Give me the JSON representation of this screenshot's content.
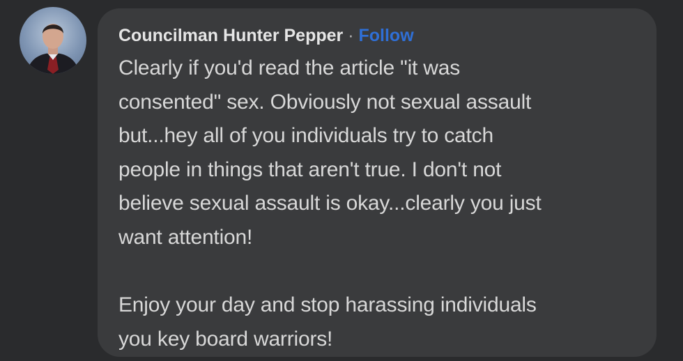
{
  "comment": {
    "author_name": "Councilman Hunter Pepper",
    "separator": "·",
    "follow_label": "Follow",
    "body": "Clearly if you'd read the article \"it was\nconsented\" sex. Obviously not sexual assault\nbut...hey all of you individuals try to catch\npeople in things that aren't true. I don't not\nbelieve sexual assault is okay...clearly you just\nwant attention!\n\nEnjoy your day and stop harassing individuals\nyou key board warriors!"
  },
  "colors": {
    "background": "#2a2b2d",
    "bubble": "#3a3b3d",
    "name_text": "#e6e6e6",
    "body_text": "#d8d8d8",
    "follow_link": "#2f6fd6"
  }
}
